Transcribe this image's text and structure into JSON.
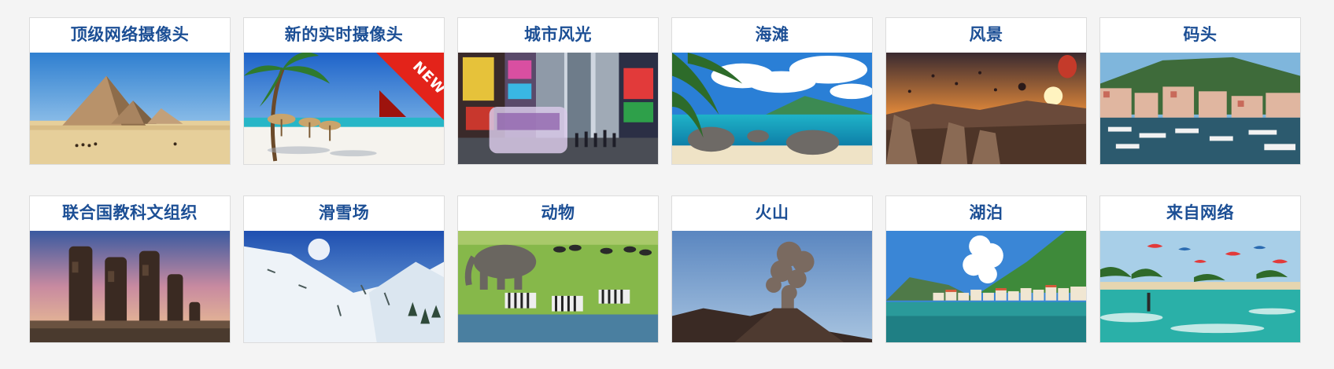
{
  "cams": [
    {
      "title": "顶级网络摄像头",
      "icon": "pyramids-photo"
    },
    {
      "title": "新的实时摄像头",
      "icon": "beach-palm-photo",
      "badge": "NEW"
    },
    {
      "title": "城市风光",
      "icon": "times-square-photo"
    },
    {
      "title": "海滩",
      "icon": "tropical-beach-photo"
    },
    {
      "title": "风景",
      "icon": "balloons-landscape-photo"
    },
    {
      "title": "码头",
      "icon": "harbor-photo"
    },
    {
      "title": "联合国教科文组织",
      "icon": "moai-statues-photo"
    },
    {
      "title": "滑雪场",
      "icon": "ski-slope-photo"
    },
    {
      "title": "动物",
      "icon": "safari-animals-photo"
    },
    {
      "title": "火山",
      "icon": "volcano-photo"
    },
    {
      "title": "湖泊",
      "icon": "lake-village-photo"
    },
    {
      "title": "来自网络",
      "icon": "kitesurf-photo"
    }
  ]
}
